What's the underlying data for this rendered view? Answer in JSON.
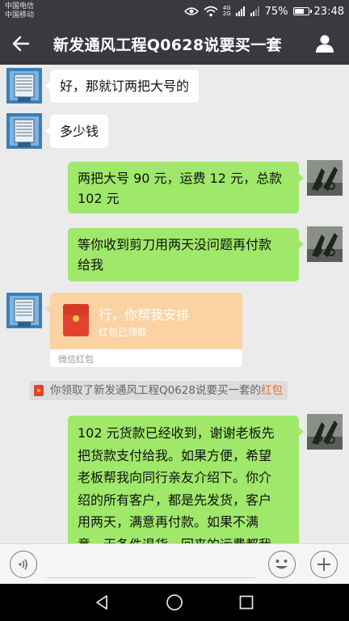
{
  "status_bar": {
    "carrier1": "中国电信",
    "carrier2": "中国移动",
    "net1": "4G",
    "net2": "2G",
    "battery_percent_text": "75%",
    "battery_level": 0.75,
    "time": "23:48"
  },
  "header": {
    "title": "新发通风工程Q0628说要买一套",
    "back_icon": "back-arrow-icon",
    "profile_icon": "person-icon"
  },
  "messages": [
    {
      "side": "in",
      "text": "好，那就订两把大号的"
    },
    {
      "side": "in",
      "text": "多少钱"
    },
    {
      "side": "out",
      "line1": "两把大号 90 元，运费 12 元，总款",
      "line2": "102 元"
    },
    {
      "side": "out",
      "line1": "等你收到剪刀用两天没问题再付款",
      "line2": "给我"
    },
    {
      "side": "in",
      "type": "red_packet",
      "text": "行，你帮我安排",
      "status": "红包已领取",
      "footer": "微信红包"
    },
    {
      "side": "system",
      "text": "你领取了新发通风工程Q0628说要买一套的",
      "link": "红包"
    },
    {
      "side": "out",
      "lines": [
        "102 元货款已经收到，谢谢老板先",
        "把货款支付给我。如果方便，希望",
        "老板帮我向同行亲友介绍下。你介",
        "绍的所有客户，都是先发货，客户",
        "用两天，满意再付款。如果不满",
        "意，无条件退货，回来的运费都我"
      ]
    }
  ],
  "input_bar": {
    "voice_icon": "voice-icon",
    "emoji_icon": "emoji-icon",
    "plus_icon": "plus-icon"
  },
  "nav_bar": {
    "back_icon": "nav-back-icon",
    "home_icon": "nav-home-icon",
    "recents_icon": "nav-recents-icon"
  },
  "colors": {
    "header_bg": "#393a3f",
    "chat_bg": "#ebebeb",
    "outgoing_bubble": "#9fe86a",
    "incoming_bubble": "#ffffff",
    "red_packet_bg": "#fbd3a2",
    "system_link": "#e6722c"
  }
}
